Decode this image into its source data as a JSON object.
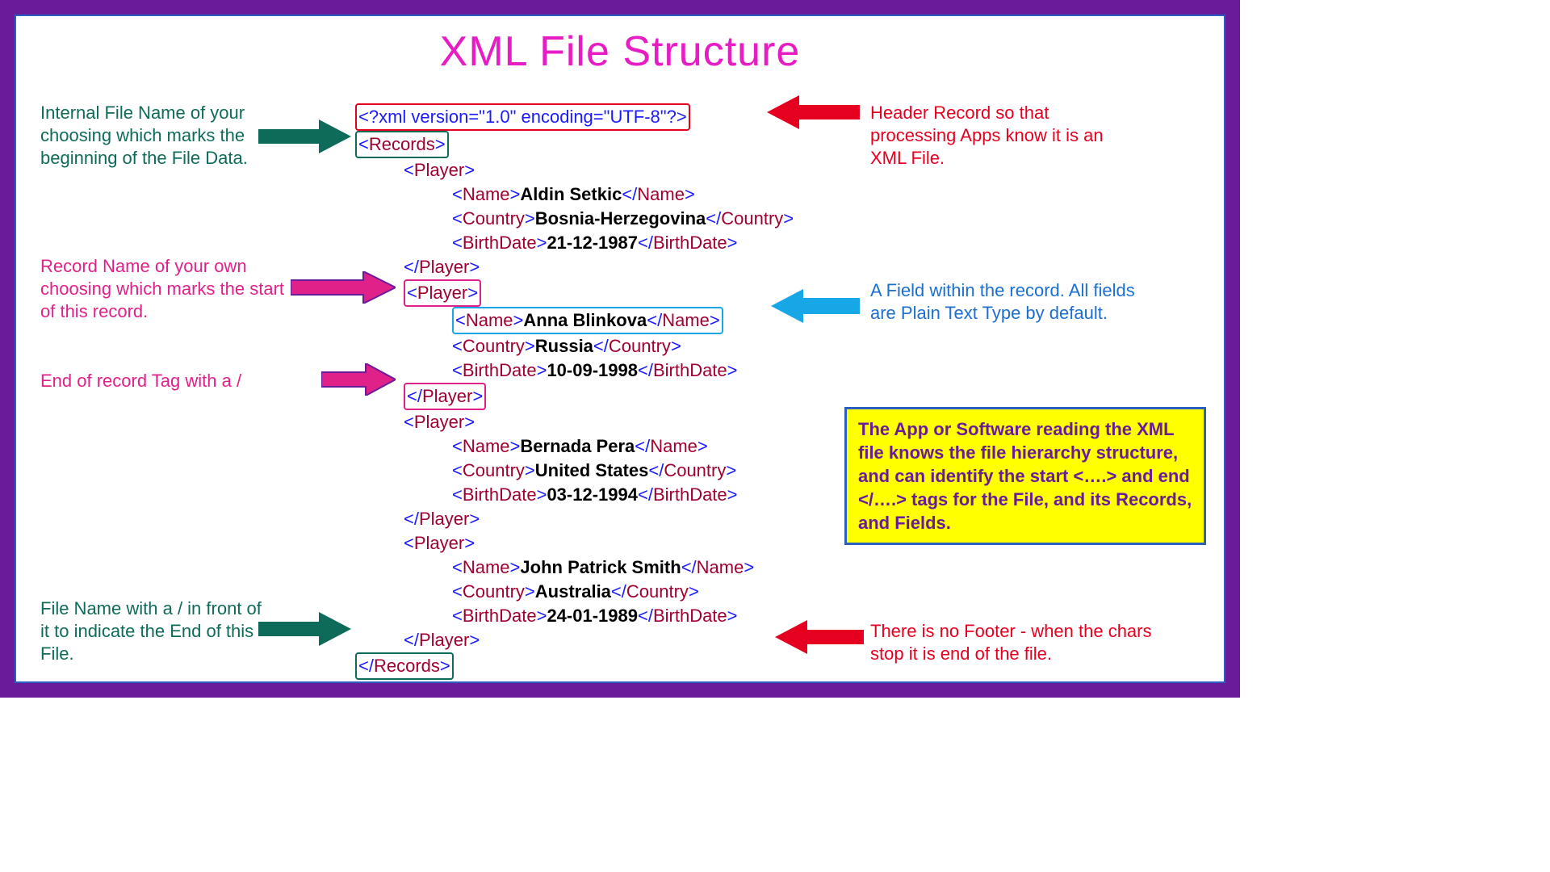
{
  "title": "XML File Structure",
  "xml": {
    "header": "<?xml version=\"1.0\" encoding=\"UTF-8\"?>",
    "root_open": "Records",
    "root_close": "Records",
    "tags": {
      "player": "Player",
      "name": "Name",
      "country": "Country",
      "birth": "BirthDate"
    },
    "players": [
      {
        "name": "Aldin Setkic",
        "country": "Bosnia-Herzegovina",
        "birth": "21-12-1987"
      },
      {
        "name": "Anna Blinkova",
        "country": "Russia",
        "birth": "10-09-1998"
      },
      {
        "name": "Bernada Pera",
        "country": "United States",
        "birth": "03-12-1994"
      },
      {
        "name": "John Patrick Smith",
        "country": "Australia",
        "birth": "24-01-1989"
      }
    ]
  },
  "annotations": {
    "internal_name": "Internal File Name of your choosing which marks the beginning of the File Data.",
    "header_record": "Header Record so that processing Apps know it is an XML File.",
    "record_name": "Record Name of your own choosing which marks the start of this record.",
    "field": "A Field within the record. All fields are Plain Text Type by default.",
    "end_record": "End of record Tag with a /",
    "file_end": "File Name with a / in front of it to indicate the End of this File.",
    "no_footer": "There is no Footer - when the chars stop it is end of the file.",
    "yellow": "The App or Software reading the XML file knows the file hierarchy structure, and can identify the start <….> and end </….> tags for the File, and its Records, and Fields."
  }
}
